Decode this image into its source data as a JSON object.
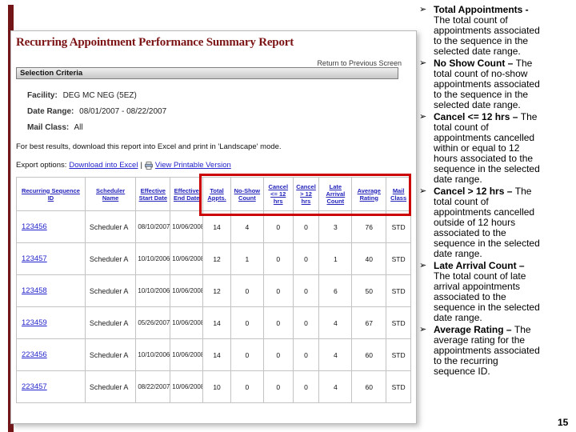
{
  "slide": {
    "page_number": "15"
  },
  "report": {
    "title": "Recurring Appointment Performance Summary Report",
    "return_link": "Return to Previous Screen",
    "selection_criteria_label": "Selection Criteria",
    "fields": [
      {
        "label": "Facility:",
        "value": "DEG MC NEG (5EZ)"
      },
      {
        "label": "Date Range:",
        "value": "08/01/2007 - 08/22/2007"
      },
      {
        "label": "Mail Class:",
        "value": "All"
      }
    ],
    "note": "For best results, download this report into Excel and print in 'Landscape' mode.",
    "export_options_label": "Export options:",
    "export_link_excel": "Download into Excel",
    "export_separator": "|",
    "export_link_print": "View Printable Version"
  },
  "table": {
    "headers": [
      "Recurring Sequence ID",
      "Scheduler Name",
      "Effective Start Date",
      "Effective End Date",
      "Total Appts.",
      "No-Show Count",
      "Cancel <= 12 hrs",
      "Cancel > 12 hrs",
      "Late Arrival Count",
      "Average Rating",
      "Mail Class"
    ],
    "rows": [
      [
        "123456",
        "Scheduler A",
        "08/10/2007",
        "10/06/2008",
        "14",
        "4",
        "0",
        "0",
        "3",
        "76",
        "STD"
      ],
      [
        "123457",
        "Scheduler A",
        "10/10/2006",
        "10/06/2008",
        "12",
        "1",
        "0",
        "0",
        "1",
        "40",
        "STD"
      ],
      [
        "123458",
        "Scheduler A",
        "10/10/2006",
        "10/06/2008",
        "12",
        "0",
        "0",
        "0",
        "6",
        "50",
        "STD"
      ],
      [
        "123459",
        "Scheduler A",
        "05/26/2007",
        "10/06/2008",
        "14",
        "0",
        "0",
        "0",
        "4",
        "67",
        "STD"
      ],
      [
        "223456",
        "Scheduler A",
        "10/10/2006",
        "10/06/2008",
        "14",
        "0",
        "0",
        "0",
        "4",
        "60",
        "STD"
      ],
      [
        "223457",
        "Scheduler A",
        "08/22/2007",
        "10/06/2008",
        "10",
        "0",
        "0",
        "0",
        "4",
        "60",
        "STD"
      ]
    ]
  },
  "annotations": {
    "bullet": "➢",
    "items": [
      {
        "title": "Total Appointments -",
        "body": "The total count of appointments associated to the sequence in the selected date range."
      },
      {
        "title": "No Show Count –",
        "body": "The total count of no-show appointments associated to the sequence in the selected date range."
      },
      {
        "title": "Cancel <= 12 hrs –",
        "body": "The total count of appointments cancelled within or equal to 12 hours associated to the sequence in the selected date range."
      },
      {
        "title": "Cancel > 12 hrs –",
        "body": "The total count of appointments cancelled outside of 12 hours associated to the sequence in the selected date range."
      },
      {
        "title": "Late Arrival Count –",
        "body": "The total count of late arrival appointments associated to the sequence in the selected date range."
      },
      {
        "title": "Average Rating –",
        "body": "The average rating for the appointments associated to the recurring sequence ID."
      }
    ]
  },
  "colors": {
    "accent_maroon": "#731417",
    "title_maroon": "#7b1315",
    "link_blue": "#2323cc",
    "highlight_red": "#cc0000"
  }
}
